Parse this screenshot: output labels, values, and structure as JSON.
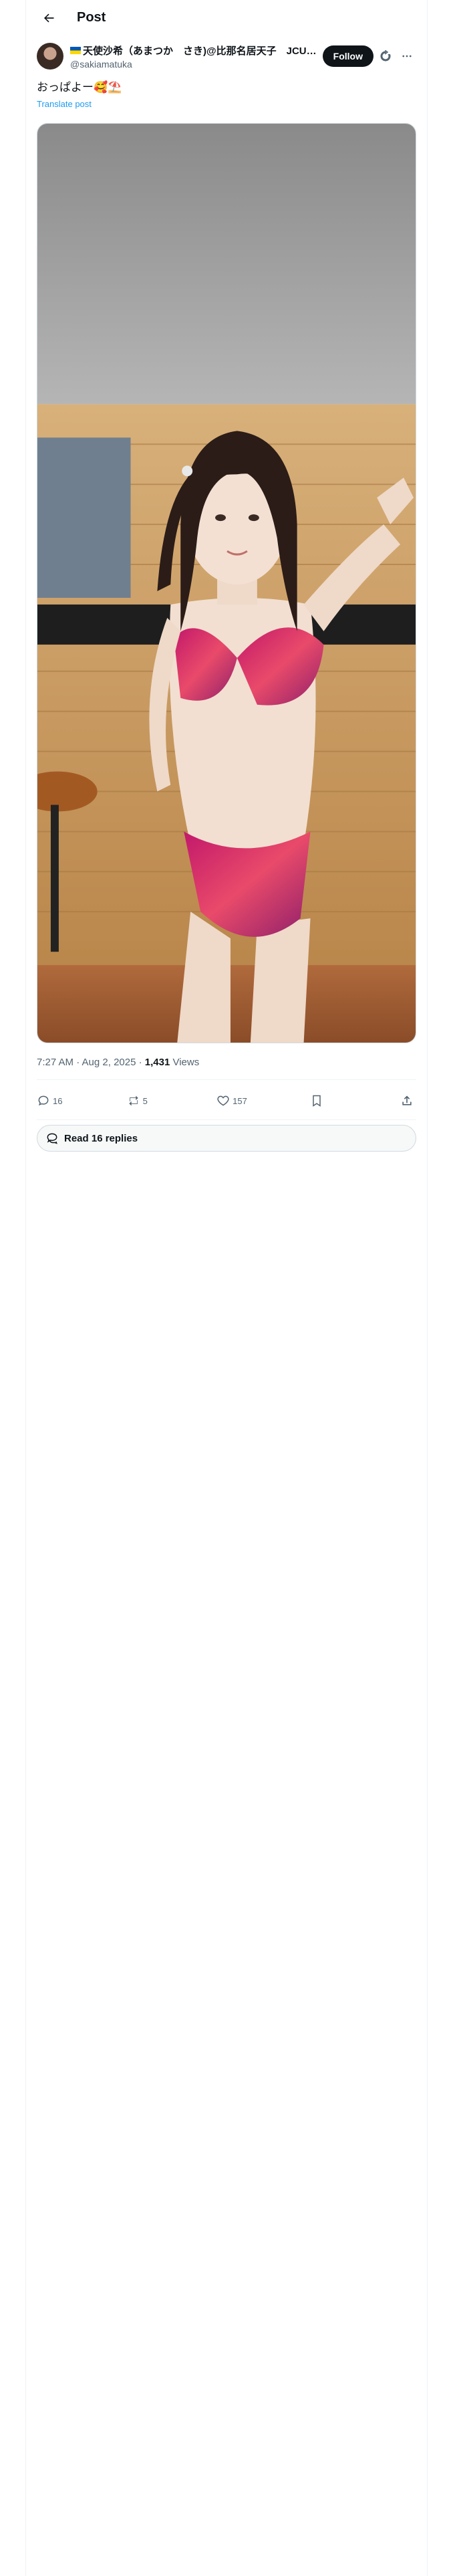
{
  "header": {
    "title": "Post"
  },
  "author": {
    "display_name": "天使沙希（あまつか　さき)@比那名居天子　JCUTI...",
    "handle": "@sakiamatuka",
    "follow_label": "Follow"
  },
  "post": {
    "text": "おっぱよー",
    "emojis": "🥰⛱️",
    "translate_label": "Translate post",
    "media_icon": "photo"
  },
  "meta": {
    "timestamp": "7:27 AM · Aug 2, 2025 · ",
    "views_count": "1,431",
    "views_label": " Views"
  },
  "actions": {
    "replies": "16",
    "reposts": "5",
    "likes": "157"
  },
  "read_replies": {
    "label": "Read 16 replies"
  },
  "icons": {
    "back": "arrow-left-icon",
    "grok": "grok-icon",
    "more": "more-icon",
    "reply": "reply-icon",
    "repost": "repost-icon",
    "like": "heart-icon",
    "bookmark": "bookmark-icon",
    "share": "share-icon",
    "replies_bubble": "speech-bubble-icon"
  }
}
